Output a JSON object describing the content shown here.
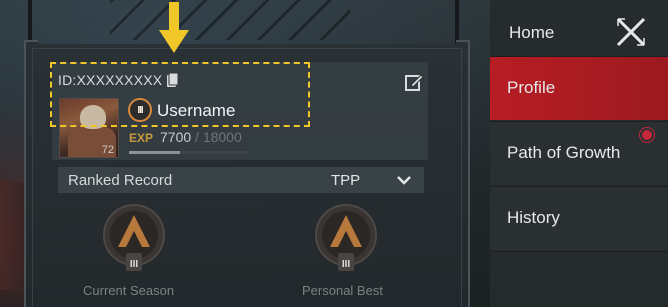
{
  "profile": {
    "id_text": "ID:XXXXXXXXX",
    "username": "Username",
    "rank_numeral": "III",
    "avatar_level": "72",
    "exp_label": "EXP",
    "exp_current": "7700",
    "exp_separator": "/",
    "exp_max": "18000",
    "exp_progress": 0.428
  },
  "ranked": {
    "title": "Ranked Record",
    "mode": "TPP",
    "current_caption": "Current Season",
    "best_caption": "Personal Best",
    "current_numeral": "III",
    "best_numeral": "III"
  },
  "menu": {
    "header": "Home",
    "items": [
      {
        "label": "Profile",
        "active": true
      },
      {
        "label": "Path of Growth",
        "active": false,
        "notification": true
      },
      {
        "label": "History",
        "active": false
      }
    ]
  },
  "colors": {
    "accent_red": "#b81d24",
    "highlight_yellow": "#f1c629",
    "exp_gold": "#c99a3d",
    "rank_orange": "#d98a3c"
  },
  "icons": [
    "copy-icon",
    "edit-icon",
    "chevron-down-icon",
    "close-icon",
    "down-arrow-icon"
  ]
}
